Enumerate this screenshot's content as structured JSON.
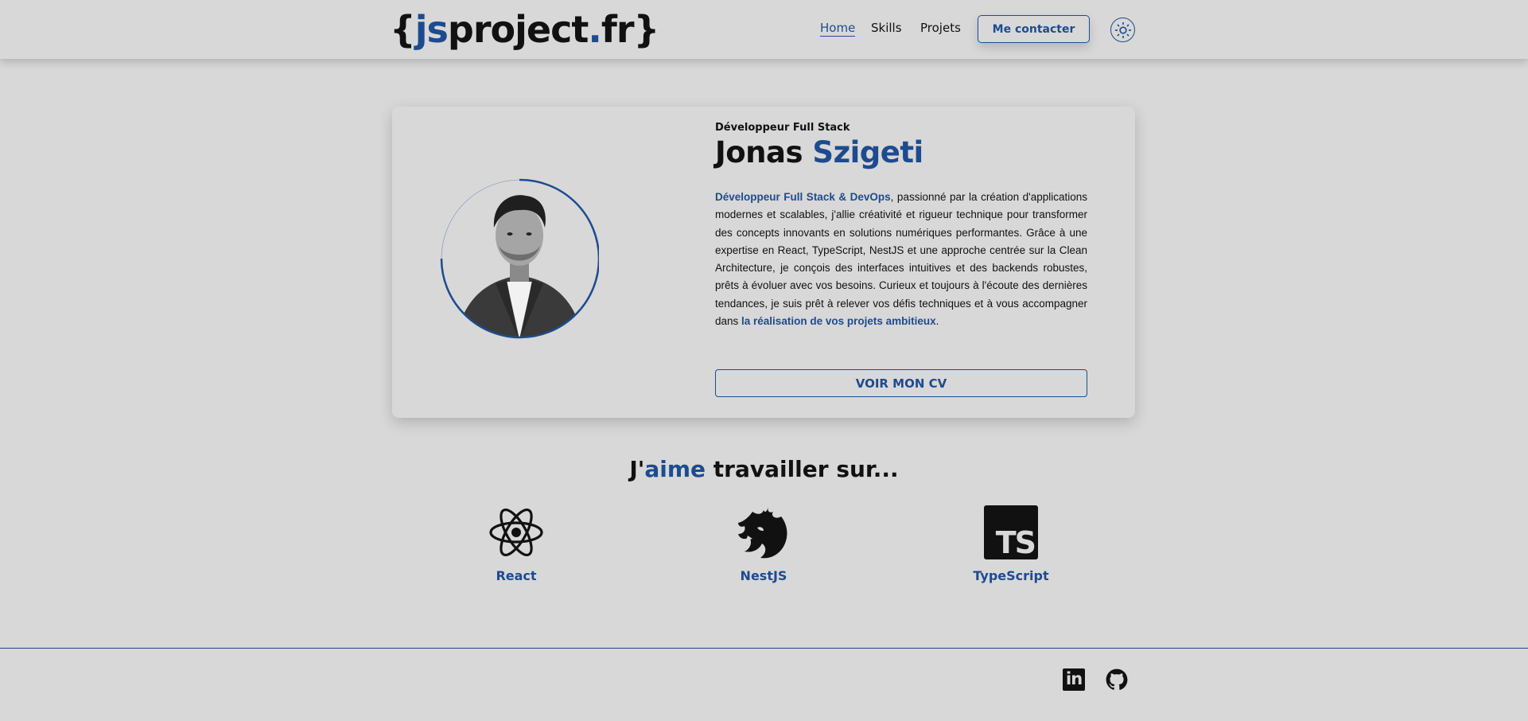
{
  "header": {
    "logo": {
      "open": "{",
      "js": "js",
      "project": "project",
      "dot": ".",
      "fr": "fr",
      "close": "}"
    },
    "nav": [
      {
        "label": "Home",
        "active": true
      },
      {
        "label": "Skills",
        "active": false
      },
      {
        "label": "Projets",
        "active": false
      }
    ],
    "contact_label": "Me contacter",
    "theme_icon": "sun-icon"
  },
  "hero": {
    "role": "Développeur Full Stack",
    "first_name": "Jonas",
    "last_name": "Szigeti",
    "bio": {
      "highlight_start": "Développeur Full Stack & DevOps",
      "body": ", passionné par la création d'applications modernes et scalables, j'allie créativité et rigueur technique pour transformer des concepts innovants en solutions numériques performantes. Grâce à une expertise en React, TypeScript, NestJS et une approche centrée sur la Clean Architecture, je conçois des interfaces intuitives et des backends robustes, prêts à évoluer avec vos besoins. Curieux et toujours à l'écoute des dernières tendances, je suis prêt à relever vos défis techniques et à vous accompagner dans ",
      "highlight_end": "la réalisation de vos projets ambitieux",
      "end": "."
    },
    "cv_label": "VOIR MON CV"
  },
  "skills": {
    "title_prefix": "J'",
    "title_accent": "aime",
    "title_suffix": " travailler sur...",
    "items": [
      {
        "label": "React",
        "icon": "react-icon"
      },
      {
        "label": "NestJS",
        "icon": "nestjs-icon"
      },
      {
        "label": "TypeScript",
        "icon": "typescript-icon",
        "badge": "TS"
      }
    ]
  },
  "footer": {
    "socials": [
      {
        "icon": "linkedin-icon",
        "badge": "in"
      },
      {
        "icon": "github-icon"
      }
    ]
  },
  "colors": {
    "accent": "#1d4b8f",
    "background": "#d8d8d8",
    "text": "#111111"
  }
}
